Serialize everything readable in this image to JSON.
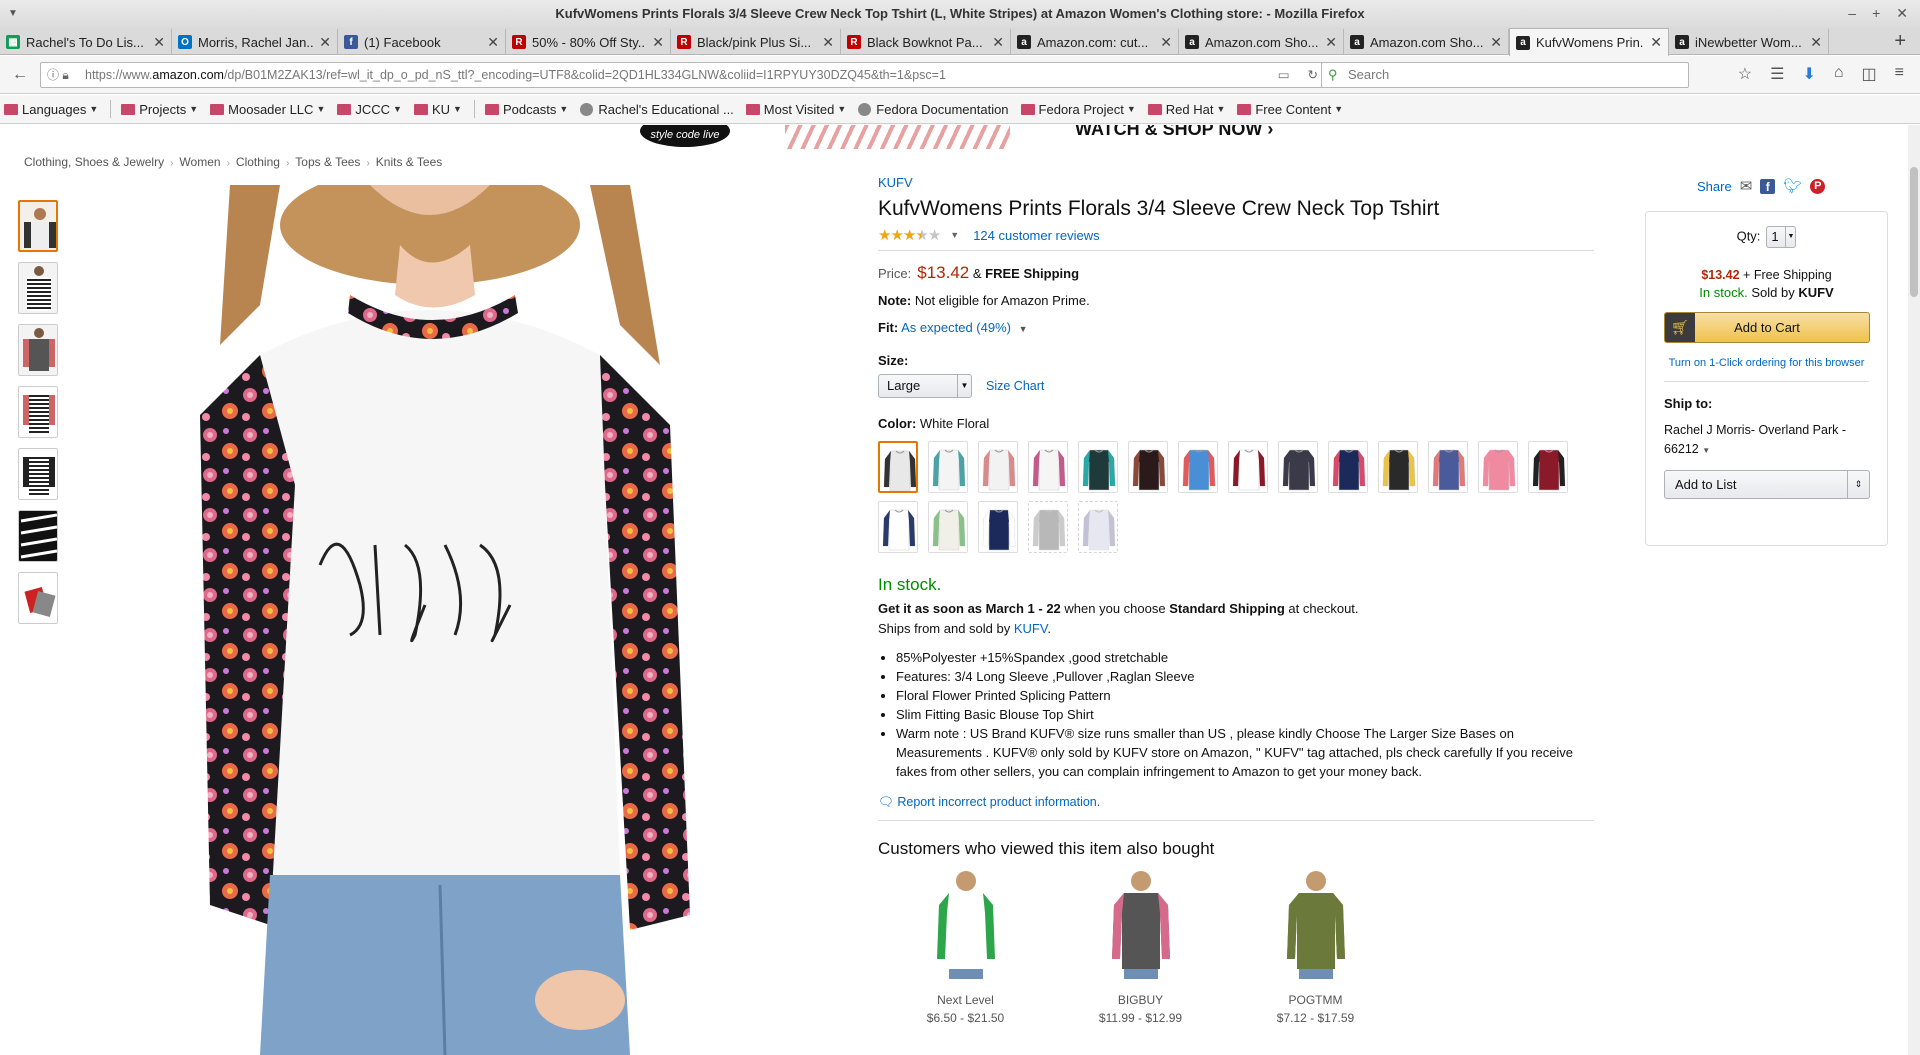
{
  "window": {
    "title": "KufvWomens Prints Florals 3/4 Sleeve Crew Neck Top Tshirt (L, White Stripes) at Amazon Women's Clothing store: - Mozilla Firefox"
  },
  "tabs": [
    {
      "label": "Rachel's To Do Lis...",
      "icon": "google-sheets-icon",
      "color": "#0f9d58",
      "glyph": "▦"
    },
    {
      "label": "Morris, Rachel Jan...",
      "icon": "outlook-icon",
      "color": "#0072c6",
      "glyph": "O"
    },
    {
      "label": "(1) Facebook",
      "icon": "facebook-icon",
      "color": "#3b5998",
      "glyph": "f"
    },
    {
      "label": "50% - 80% Off Sty...",
      "icon": "rakuten-icon",
      "color": "#bf0000",
      "glyph": "R"
    },
    {
      "label": "Black/pink Plus Si...",
      "icon": "rakuten-icon",
      "color": "#bf0000",
      "glyph": "R"
    },
    {
      "label": "Black Bowknot Pa...",
      "icon": "rakuten-icon",
      "color": "#bf0000",
      "glyph": "R"
    },
    {
      "label": "Amazon.com: cut...",
      "icon": "amazon-icon",
      "color": "#222",
      "glyph": "a"
    },
    {
      "label": "Amazon.com Sho...",
      "icon": "amazon-icon",
      "color": "#222",
      "glyph": "a"
    },
    {
      "label": "Amazon.com Sho...",
      "icon": "amazon-icon",
      "color": "#222",
      "glyph": "a"
    },
    {
      "label": "KufvWomens Prin...",
      "icon": "amazon-icon",
      "color": "#222",
      "glyph": "a",
      "active": true
    },
    {
      "label": "iNewbetter Wom...",
      "icon": "amazon-icon",
      "color": "#222",
      "glyph": "a"
    }
  ],
  "nav": {
    "url_prefix": "https://www.",
    "url_domain": "amazon.com",
    "url_rest": "/dp/B01M2ZAK13/ref=wl_it_dp_o_pd_nS_ttl?_encoding=UTF8&colid=2QD1HL334GLNW&coliid=I1RPYUY30DZQ45&th=1&psc=1",
    "search_placeholder": "Search"
  },
  "bookmarks": [
    {
      "label": "Languages",
      "type": "folder",
      "chevron": true
    },
    {
      "label": "Projects",
      "type": "folder",
      "chevron": true,
      "sep_before": true
    },
    {
      "label": "Moosader LLC",
      "type": "folder",
      "chevron": true
    },
    {
      "label": "JCCC",
      "type": "folder",
      "chevron": true
    },
    {
      "label": "KU",
      "type": "folder",
      "chevron": true
    },
    {
      "label": "Podcasts",
      "type": "folder",
      "chevron": true,
      "sep_before": true
    },
    {
      "label": "Rachel's Educational ...",
      "type": "link"
    },
    {
      "label": "Most Visited",
      "type": "folder",
      "chevron": true
    },
    {
      "label": "Fedora Documentation",
      "type": "link"
    },
    {
      "label": "Fedora Project",
      "type": "folder",
      "chevron": true
    },
    {
      "label": "Red Hat",
      "type": "folder",
      "chevron": true
    },
    {
      "label": "Free Content",
      "type": "folder",
      "chevron": true
    }
  ],
  "banner": {
    "logo_text": "style code live",
    "text": "WATCH & SHOP NOW ›"
  },
  "breadcrumb": [
    "Clothing, Shoes & Jewelry",
    "Women",
    "Clothing",
    "Tops & Tees",
    "Knits & Tees"
  ],
  "product": {
    "brand": "KUFV",
    "title": "KufvWomens Prints Florals 3/4 Sleeve Crew Neck Top Tshirt",
    "rating": 3.5,
    "reviews": "124 customer reviews",
    "price_label": "Price:",
    "price": "$13.42",
    "shipping_amp": "&",
    "shipping": "FREE Shipping",
    "note_label": "Note:",
    "note": "Not eligible for Amazon Prime.",
    "fit_label": "Fit:",
    "fit": "As expected (49%)",
    "size_label": "Size:",
    "size_value": "Large",
    "size_chart": "Size Chart",
    "color_label": "Color:",
    "color_value": "White Floral",
    "stock": "In stock.",
    "delivery_pre": "Get it as soon as March 1 - 22",
    "delivery_mid": "when you choose",
    "delivery_ship": "Standard Shipping",
    "delivery_post": "at checkout.",
    "ships_pre": "Ships from and sold by",
    "ships_seller": "KUFV",
    "bullets": [
      "85%Polyester +15%Spandex ,good stretchable",
      "Features: 3/4 Long Sleeve ,Pullover ,Raglan Sleeve",
      "Floral Flower Printed Splicing Pattern",
      "Slim Fitting Basic Blouse Top Shirt",
      "Warm note : US Brand KUFV® size runs smaller than US , please kindly Choose The Larger Size Bases on Measurements . KUFV® only sold by KUFV store on Amazon, \" KUFV\" tag attached, pls check carefully If you receive fakes from other sellers, you can complain infringement to Amazon to get your money back."
    ],
    "report": "Report incorrect product information."
  },
  "swatches": [
    {
      "body": "#e8e8e8",
      "sleeve": "#333",
      "selected": true
    },
    {
      "body": "#f4f4f4",
      "sleeve": "#4ba3a8"
    },
    {
      "body": "#f2f2f2",
      "sleeve": "#d98a8a"
    },
    {
      "body": "#f5f5f5",
      "sleeve": "#c25b8a"
    },
    {
      "body": "#1e3a3a",
      "sleeve": "#2aa8a8"
    },
    {
      "body": "#2b1a1a",
      "sleeve": "#8a4a3a"
    },
    {
      "body": "#4a8fd6",
      "sleeve": "#e05b5b"
    },
    {
      "body": "#ffffff",
      "sleeve": "#8a1a2a"
    },
    {
      "body": "#3a3a48",
      "sleeve": "#3a3a48"
    },
    {
      "body": "#1b2a5a",
      "sleeve": "#d64a6a"
    },
    {
      "body": "#2a2a2a",
      "sleeve": "#e8c44a"
    },
    {
      "body": "#4a5a9a",
      "sleeve": "#e07a7a"
    },
    {
      "body": "#f08aa0",
      "sleeve": "#f08aa0"
    },
    {
      "body": "#8a1a2a",
      "sleeve": "#222"
    },
    {
      "body": "#ffffff",
      "sleeve": "#2a3a6a"
    },
    {
      "body": "#f0f0e8",
      "sleeve": "#8ac08a"
    },
    {
      "body": "#1b2a5a",
      "sleeve": "#ffffff"
    },
    {
      "body": "#8a8a8a",
      "sleeve": "#aaaaaa",
      "unavailable": true
    },
    {
      "body": "#d8d8e8",
      "sleeve": "#9a9ab8",
      "unavailable": true
    }
  ],
  "related": {
    "heading": "Customers who viewed this item also bought",
    "items": [
      {
        "brand": "Next Level",
        "price": "$6.50 - $21.50",
        "body": "#ffffff",
        "sleeve": "#2da54a"
      },
      {
        "brand": "BIGBUY",
        "price": "$11.99 - $12.99",
        "body": "#555",
        "sleeve": "#d66a8a"
      },
      {
        "brand": "POGTMM",
        "price": "$7.12 - $17.59",
        "body": "#6b7a3a",
        "sleeve": "#6b7a3a"
      }
    ]
  },
  "share": {
    "label": "Share"
  },
  "buybox": {
    "qty_label": "Qty:",
    "qty_value": "1",
    "price": "$13.42",
    "shipping": "+ Free Shipping",
    "stock": "In stock.",
    "sold_by_pre": "Sold by",
    "sold_by": "KUFV",
    "add_to_cart": "Add to Cart",
    "one_click": "Turn on 1-Click ordering for this browser",
    "ship_to_label": "Ship to:",
    "address": "Rachel J Morris- Overland Park - 66212",
    "add_to_list": "Add to List"
  },
  "colors": {
    "accent_link": "#0066c0",
    "price": "#b12704",
    "in_stock": "#008a00",
    "selected_border": "#e77600"
  }
}
